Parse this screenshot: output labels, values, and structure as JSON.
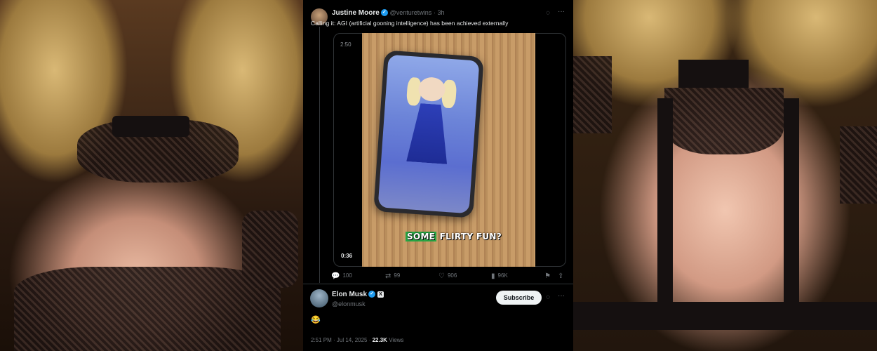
{
  "original_tweet": {
    "author_name": "Justine Moore",
    "author_handle": "@venturetwins",
    "time_ago": "· 3h",
    "text": "Calling it: AGI (artificial gooning intelligence) has been achieved externally",
    "media": {
      "elapsed_time": "2:50",
      "remaining_time": "0:36",
      "caption_highlight": "SOME",
      "caption_rest": " FLIRTY FUN?"
    },
    "actions": {
      "replies": "100",
      "reposts": "99",
      "likes": "906",
      "views": "96K"
    }
  },
  "reply": {
    "author_name": "Elon Musk",
    "author_handle": "@elonmusk",
    "subscribe_label": "Subscribe",
    "text": "😂",
    "timestamp": "2:51 PM · Jul 14, 2025 · ",
    "views_count": "22.3K",
    "views_label": " Views"
  },
  "colors": {
    "verified": "#1d9bf0",
    "caption_highlight": "#27a745",
    "background": "#000000",
    "muted_text": "#71767b"
  },
  "icons": [
    "grok-icon",
    "more-icon",
    "reply-icon",
    "repost-icon",
    "like-icon",
    "views-icon",
    "bookmark-icon",
    "share-icon",
    "verified-icon",
    "x-badge-icon"
  ]
}
